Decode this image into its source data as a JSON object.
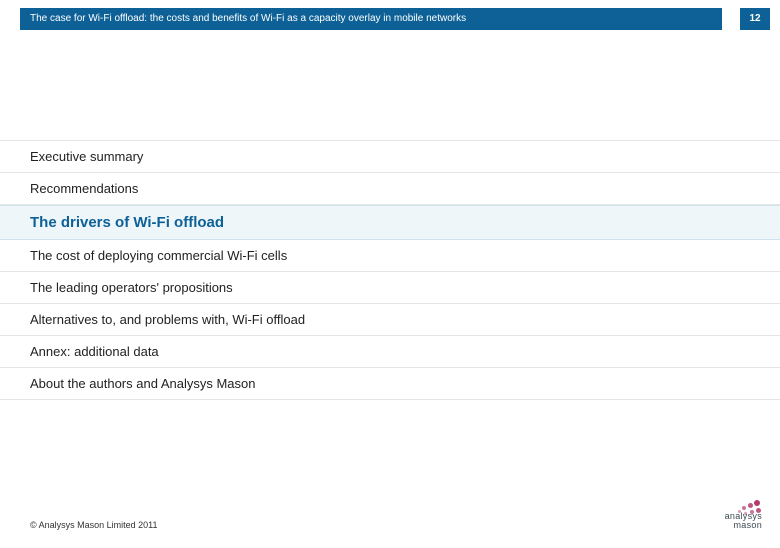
{
  "header": {
    "title": "The case for Wi-Fi offload: the costs and benefits of Wi-Fi as a capacity overlay in mobile networks",
    "page_number": "12"
  },
  "toc": {
    "items": [
      {
        "label": "Executive summary",
        "active": false
      },
      {
        "label": "Recommendations",
        "active": false
      },
      {
        "label": "The drivers of Wi-Fi offload",
        "active": true
      },
      {
        "label": "The cost of deploying commercial Wi-Fi cells",
        "active": false
      },
      {
        "label": "The leading operators' propositions",
        "active": false
      },
      {
        "label": "Alternatives to, and problems with, Wi-Fi offload",
        "active": false
      },
      {
        "label": "Annex: additional data",
        "active": false
      },
      {
        "label": "About the authors and Analysys Mason",
        "active": false
      }
    ]
  },
  "footer": {
    "copyright": "© Analysys Mason Limited 2011",
    "logo_line1": "analysys",
    "logo_line2": "mason"
  }
}
